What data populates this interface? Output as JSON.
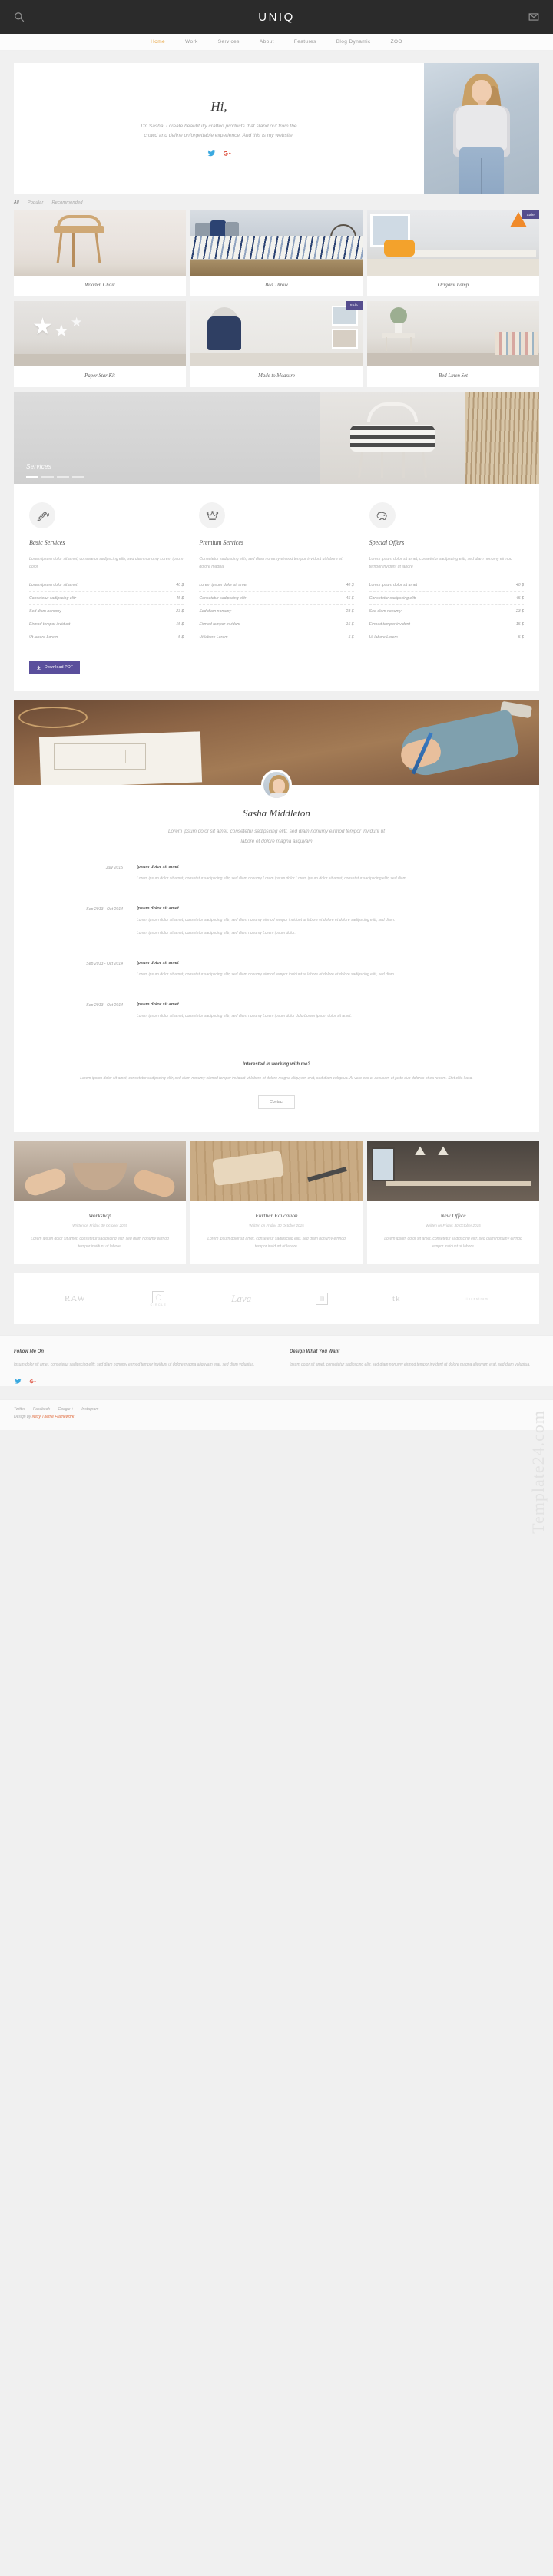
{
  "topbar": {
    "brand": "UNIQ",
    "search_icon": "search-icon",
    "mail_icon": "mail-icon"
  },
  "nav": {
    "items": [
      {
        "label": "Home",
        "active": true
      },
      {
        "label": "Work",
        "active": false
      },
      {
        "label": "Services",
        "active": false
      },
      {
        "label": "About",
        "active": false
      },
      {
        "label": "Features",
        "active": false
      },
      {
        "label": "Blog Dynamic",
        "active": false
      },
      {
        "label": "ZOO",
        "active": false
      }
    ],
    "accent_color": "#e8a33d"
  },
  "hero": {
    "greeting": "Hi,",
    "description": "I'm Sasha. I create beautifully crafted products that stand out from the crowd and define unforgettable experience. And this is my website.",
    "social": [
      {
        "name": "twitter-icon",
        "color": "#3aa9e0"
      },
      {
        "name": "google-plus-icon",
        "color": "#dc4a38"
      }
    ]
  },
  "filter": {
    "items": [
      {
        "label": "All",
        "active": true
      },
      {
        "label": "Popular",
        "active": false
      },
      {
        "label": "Recommended",
        "active": false
      }
    ]
  },
  "portfolio": {
    "items": [
      {
        "title": "Wooden Chair",
        "badge": null,
        "scene": "t-chair"
      },
      {
        "title": "Bed Throw",
        "badge": null,
        "scene": "t-bed"
      },
      {
        "title": "Origami Lamp",
        "badge": "Sale",
        "scene": "t-origami"
      },
      {
        "title": "Paper Star Kit",
        "badge": null,
        "scene": "t-star"
      },
      {
        "title": "Made to Measure",
        "badge": "Sale",
        "scene": "t-measure"
      },
      {
        "title": "Bed Linen Set",
        "badge": null,
        "scene": "t-linen"
      }
    ],
    "badge_color": "#554d8e"
  },
  "banner": {
    "caption": "Services",
    "slides": 4,
    "active_slide": 1
  },
  "services": {
    "columns": [
      {
        "icon": "pencil-ruler-icon",
        "title": "Basic Services",
        "description": "Lorem ipsum dolor sit amet, consetetur sadipscing elitr, sed diam nonumy Lorem ipsum dolor",
        "rows": [
          {
            "label": "Lorem ipsum dolor sit amet",
            "price": "40 $"
          },
          {
            "label": "Consetetur sadipscing elitr",
            "price": "45 $"
          },
          {
            "label": "Sed diam nonumy",
            "price": "23 $"
          },
          {
            "label": "Eirmod tempor invidunt",
            "price": "15 $"
          },
          {
            "label": "Ut labore Lorem",
            "price": "5 $"
          }
        ]
      },
      {
        "icon": "crown-icon",
        "title": "Premium Services",
        "description": "Consetetur sadipscing elitr, sed diam nonumy eirmod tempor invidunt ut labore et dolore magna",
        "rows": [
          {
            "label": "Lorem ipsum dolor sit amet",
            "price": "40 $"
          },
          {
            "label": "Consetetur sadipscing elitr",
            "price": "45 $"
          },
          {
            "label": "Sed diam nonumy",
            "price": "23 $"
          },
          {
            "label": "Eirmod tempor invidunt",
            "price": "15 $"
          },
          {
            "label": "Ut labore Lorem",
            "price": "5 $"
          }
        ]
      },
      {
        "icon": "piggy-bank-icon",
        "title": "Special Offers",
        "description": "Lorem ipsum dolor sit amet, consetetur sadipscing elitr, sed diam nonumy eirmod tempor invidunt ut labore",
        "rows": [
          {
            "label": "Lorem ipsum dolor sit amet",
            "price": "40 $"
          },
          {
            "label": "Consetetur sadipscing elitr",
            "price": "45 $"
          },
          {
            "label": "Sed diam nonumy",
            "price": "23 $"
          },
          {
            "label": "Eirmod tempor invidunt",
            "price": "15 $"
          },
          {
            "label": "Ut labore Lorem",
            "price": "5 $"
          }
        ]
      }
    ],
    "download_button": {
      "label": "Download PDF",
      "icon": "download-icon",
      "color": "#5a4f9c"
    }
  },
  "about": {
    "name": "Sasha Middleton",
    "lead": "Lorem ipsum dolor sit amet, consetetur sadipscing elitr, sed diam nonumy eirmod tempor invidunt ut labore et dolore magna aliquyam"
  },
  "timeline": {
    "rows": [
      {
        "date": "July 2015",
        "title": "Ipsum dolor sit amet",
        "paragraphs": [
          "Lorem ipsum dolor sit amet, consetetur sadipscing elitr, sed diam nonumy Lorem ipsum dolor Lorem ipsum dolor sit amet, consetetur sadipscing elitr, sed diam."
        ]
      },
      {
        "date": "Sep 2013 - Oct 2014",
        "title": "Ipsum dolor sit amet",
        "paragraphs": [
          "Lorem ipsum dolor sit amet, consetetur sadipscing elitr, sed diam nonumy eirmod tempor invidunt ut labore et dolore et dolore sadipscing elitr, sed diam.",
          "Lorem ipsum dolor sit amet, consetetur sadipscing elitr, sed diam nonumy Lorem ipsum dolor."
        ]
      },
      {
        "date": "Sep 2013 - Oct 2014",
        "title": "Ipsum dolor sit amet",
        "paragraphs": [
          "Lorem ipsum dolor sit amet, consetetur sadipscing elitr, sed diam nonumy eirmod tempor invidunt ut labore et dolore et dolore sadipscing elitr, sed diam."
        ]
      },
      {
        "date": "Sep 2013 - Oct 2014",
        "title": "Ipsum dolor sit amet",
        "paragraphs": [
          "Lorem ipsum dolor sit amet, consetetur sadipscing elitr, sed diam nonumy Lorem ipsum dolor dolorLorem ipsum dolor sit amet."
        ]
      }
    ]
  },
  "cta": {
    "title": "Interested in working with me?",
    "text": "Lorem ipsum dolor sit amet, consetetur sadipscing elitr, sed diam nonumy eirmod tempor invidunt ut labore et dolore magna aliquyam erat, sed diam voluptua. At vero eos et accusam et justo duo dolores et ea rebum. Stet clita kasd.",
    "button": "Contact"
  },
  "blog": {
    "posts": [
      {
        "title": "Workshop",
        "meta": "Written on Friday, 30 October 2015",
        "text": "Lorem ipsum dolor sit amet, consetetur sadipscing elitr, sed diam nonumy eirmod tempor invidunt ut labore.",
        "scene": "bt-pot"
      },
      {
        "title": "Further Education",
        "meta": "Written on Friday, 30 October 2015",
        "text": "Lorem ipsum dolor sit amet, consetetur sadipscing elitr, sed diam nonumy eirmod tempor invidunt ut labore.",
        "scene": "bt-wood"
      },
      {
        "title": "New Office",
        "meta": "Written on Friday, 30 October 2015",
        "text": "Lorem ipsum dolor sit amet, consetetur sadipscing elitr, sed diam nonumy eirmod tempor invidunt ut labore.",
        "scene": "bt-office"
      }
    ]
  },
  "clients": {
    "logos": [
      {
        "primary": "RAW",
        "secondary": ""
      },
      {
        "primary": "",
        "secondary": "CIRCLE"
      },
      {
        "primary": "Lava",
        "secondary": ""
      },
      {
        "primary": "",
        "secondary": ""
      },
      {
        "primary": "tk",
        "secondary": ""
      },
      {
        "primary": "lindestrom",
        "secondary": ""
      }
    ]
  },
  "footer": {
    "columns": [
      {
        "title": "Follow Me On",
        "text": "Ipsum dolor sit amet, consetetur sadipscing elitr, sed diam nonumy eirmod tempor invidunt ut dolore magna aliquyam erat, sed diam voluptua.",
        "has_social": true
      },
      {
        "title": "Design What You Want",
        "text": "Ipsum dolor sit amet, consetetur sadipscing elitr, sed diam nonumy eirmod tempor invidunt ut dolore magna aliquyam erat, sed diam voluptua.",
        "has_social": false
      }
    ],
    "social": [
      {
        "name": "twitter-icon",
        "color": "#3aa9e0"
      },
      {
        "name": "google-plus-icon",
        "color": "#dc4a38"
      }
    ],
    "bottom_links": [
      "Twitter",
      "Facebook",
      "Google +",
      "Instagram"
    ],
    "copyright_prefix": "Design by ",
    "copyright_brand": "Nexy Theme Framework"
  },
  "watermark": "Template24.com"
}
